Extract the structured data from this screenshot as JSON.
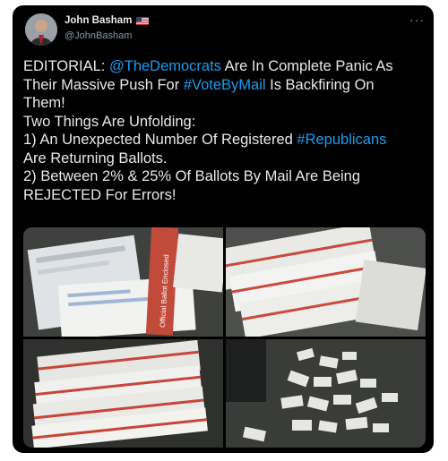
{
  "tweet": {
    "author": {
      "name": "John Basham",
      "handle": "@JohnBasham",
      "flag_icon": "us-flag-icon"
    },
    "more_glyph": "···",
    "lines": [
      [
        {
          "t": "EDITORIAL: "
        },
        {
          "t": "@TheDemocrats",
          "link": true
        },
        {
          "t": " Are In Complete Panic As"
        }
      ],
      [
        {
          "t": "Their Massive Push For "
        },
        {
          "t": "#VoteByMail",
          "link": true
        },
        {
          "t": " Is Backfiring On"
        }
      ],
      [
        {
          "t": "Them!"
        }
      ],
      [
        {
          "t": "Two Things Are Unfolding:"
        }
      ],
      [
        {
          "t": "1) An Unexpected Number Of Registered "
        },
        {
          "t": "#Republicans",
          "link": true
        }
      ],
      [
        {
          "t": "Are Returning Ballots."
        }
      ],
      [
        {
          "t": "2) Between 2% & 25% Of Ballots By Mail Are Being"
        }
      ],
      [
        {
          "t": "REJECTED For Errors!"
        }
      ]
    ],
    "photos": [
      {
        "name": "photo-ballot-envelopes-1",
        "stamp": "Official Ballot Enclosed"
      },
      {
        "name": "photo-ballot-envelopes-2"
      },
      {
        "name": "photo-ballot-envelopes-3"
      },
      {
        "name": "photo-scattered-ballots-4"
      }
    ]
  },
  "colors": {
    "background": "#000000",
    "text": "#e7e9ea",
    "secondary": "#8b98a5",
    "link": "#1d9bf0"
  }
}
